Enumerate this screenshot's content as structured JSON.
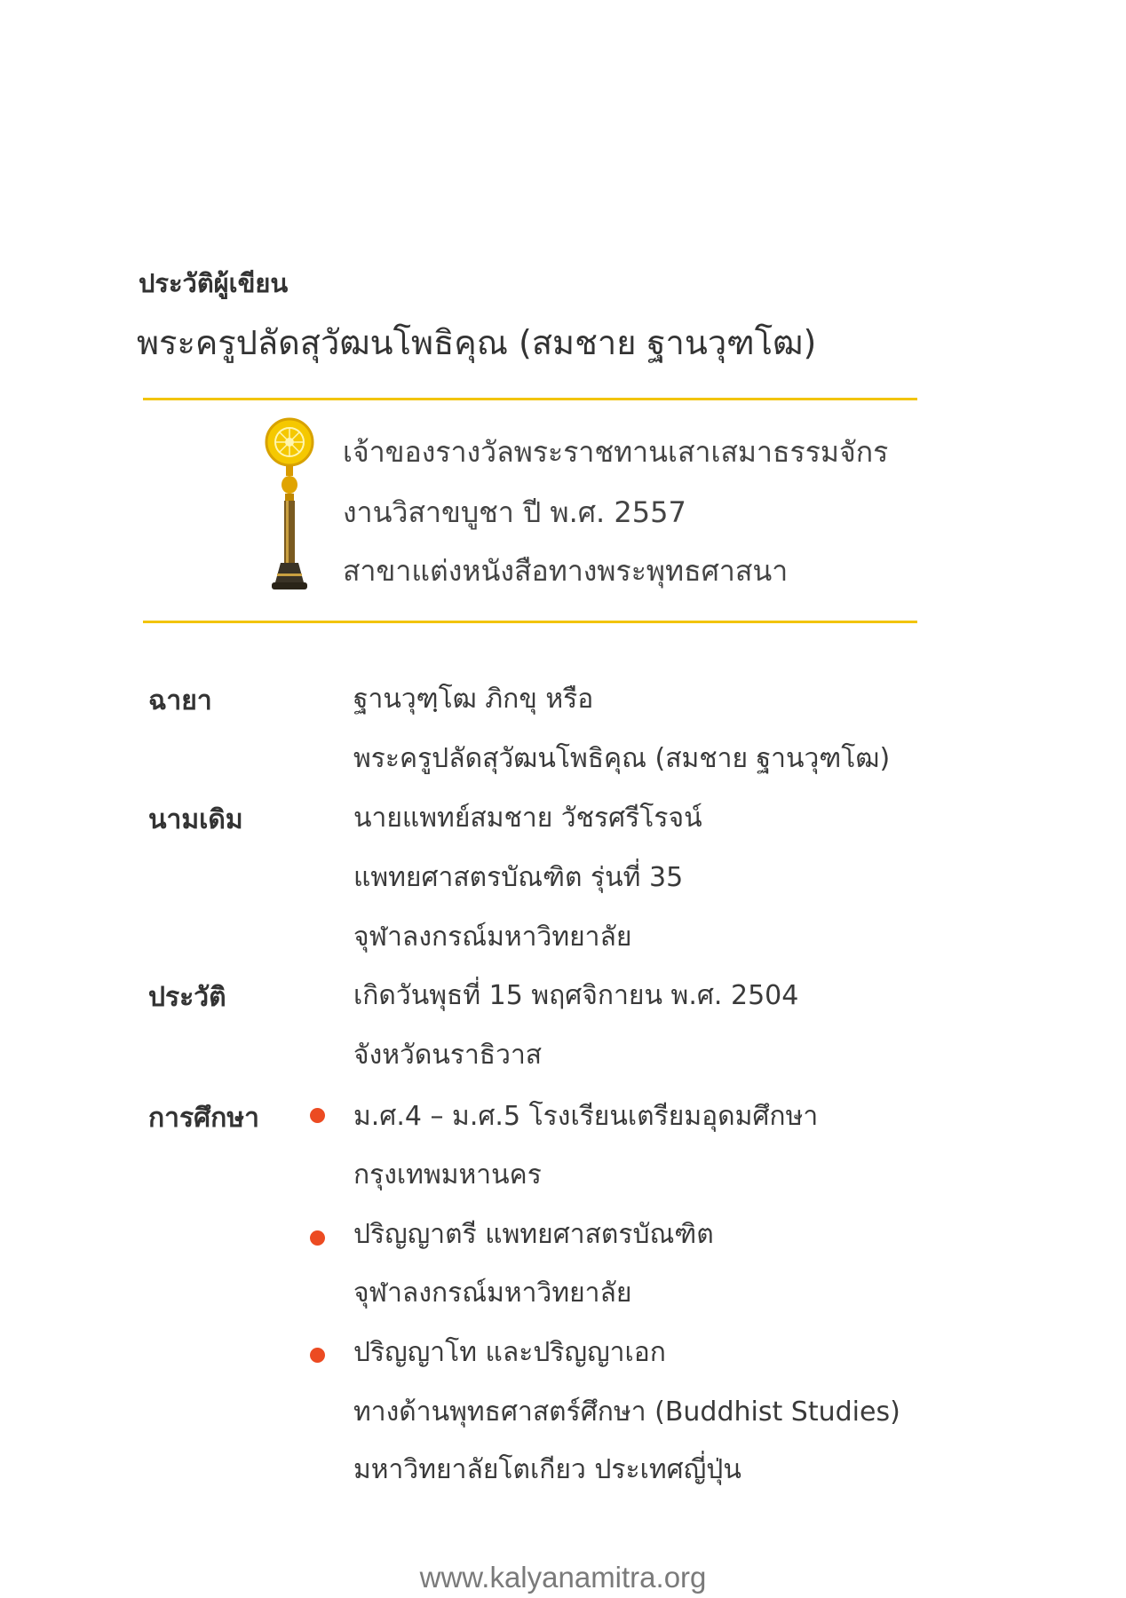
{
  "header": {
    "heading": "ประวัติผู้เขียน",
    "title": "พระครูปลัดสุวัฒนโพธิคุณ (สมชาย ฐานวุฑโฒ)"
  },
  "award": {
    "icon": "dhammachakra-trophy-icon",
    "lines": [
      "เจ้าของรางวัลพระราชทานเสาเสมาธรรมจักร",
      "งานวิสาขบูชา ปี พ.ศ. 2557",
      "สาขาแต่งหนังสือทางพระพุทธศาสนา"
    ]
  },
  "bio": {
    "alias_label": "ฉายา",
    "alias": [
      "ฐานวุฑฺโฒ ภิกขุ หรือ",
      "พระครูปลัดสุวัฒนโพธิคุณ (สมชาย ฐานวุฑโฒ)"
    ],
    "former_name_label": "นามเดิม",
    "former_name": [
      "นายแพทย์สมชาย วัชรศรีโรจน์",
      "แพทยศาสตรบัณฑิต รุ่นที่ 35",
      "จุฬาลงกรณ์มหาวิทยาลัย"
    ],
    "history_label": "ประวัติ",
    "history": [
      "เกิดวันพุธที่ 15 พฤศจิกายน พ.ศ. 2504",
      "จังหวัดนราธิวาส"
    ],
    "education_label": "การศึกษา",
    "education": [
      [
        "ม.ศ.4 – ม.ศ.5 โรงเรียนเตรียมอุดมศึกษา",
        "กรุงเทพมหานคร"
      ],
      [
        "ปริญญาตรี แพทยศาสตรบัณฑิต",
        "จุฬาลงกรณ์มหาวิทยาลัย"
      ],
      [
        "ปริญญาโท และปริญญาเอก",
        "ทางด้านพุทธศาสตร์ศึกษา (Buddhist Studies)",
        "มหาวิทยาลัยโตเกียว ประเทศญี่ปุ่น"
      ]
    ]
  },
  "footer": {
    "url": "www.kalyanamitra.org"
  },
  "colors": {
    "rule": "#f2c40c",
    "bullet": "#ec4b22"
  }
}
